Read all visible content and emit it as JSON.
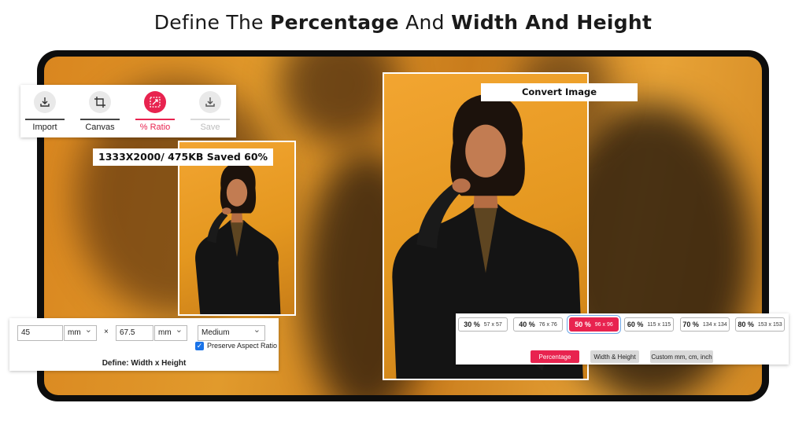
{
  "headline": {
    "part1": "Define The ",
    "part2": "Percentage",
    "part3": " And ",
    "part4": "Width And Height"
  },
  "toolbar": {
    "items": [
      {
        "label": "Import",
        "icon": "import-icon"
      },
      {
        "label": "Canvas",
        "icon": "crop-icon"
      },
      {
        "label": "% Ratio",
        "icon": "resize-icon",
        "active": true
      },
      {
        "label": "Save",
        "icon": "download-icon",
        "disabled": true
      }
    ]
  },
  "preview": {
    "info": "1333X2000/ 475KB Saved 60%"
  },
  "result": {
    "title": "Convert Image"
  },
  "dimensions": {
    "width_value": "45",
    "width_unit": "mm",
    "times": "×",
    "height_value": "67.5",
    "height_unit": "mm",
    "quality": "Medium",
    "preserve_label": "Preserve Aspect Ratio",
    "preserve_checked": true,
    "footer": "Define: Width x Height"
  },
  "ratio": {
    "options": [
      {
        "pct": "30 %",
        "size": "57 x 57"
      },
      {
        "pct": "40 %",
        "size": "76 x 76"
      },
      {
        "pct": "50 %",
        "size": "96 x 96",
        "selected": true
      },
      {
        "pct": "60 %",
        "size": "115 x 115"
      },
      {
        "pct": "70 %",
        "size": "134 x 134"
      },
      {
        "pct": "80 %",
        "size": "153 x 153"
      }
    ],
    "modes": [
      {
        "label": "Percentage",
        "active": true
      },
      {
        "label": "Width & Height"
      },
      {
        "label": "Custom mm, cm, inch"
      }
    ]
  },
  "colors": {
    "accent": "#e8234f",
    "backdrop": "#dd9427",
    "frame": "#0d0d0d",
    "check": "#1a73e8"
  }
}
